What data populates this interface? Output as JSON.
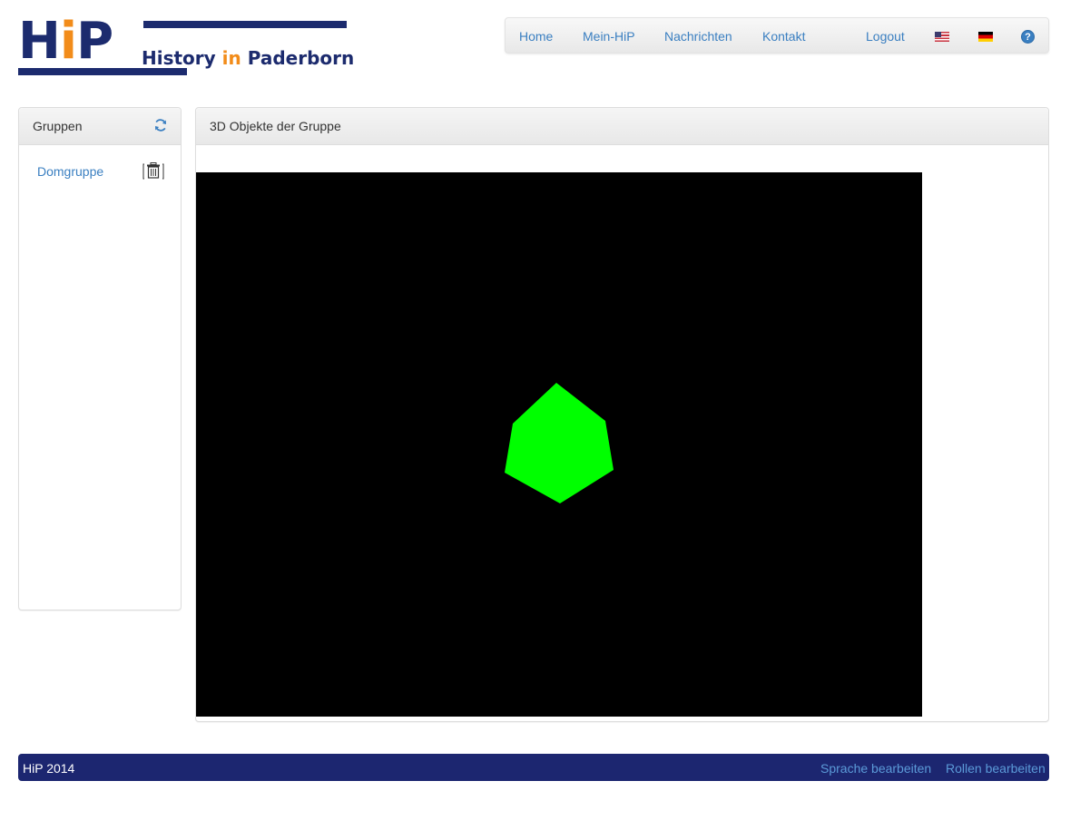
{
  "logo": {
    "hip_prefix": "H",
    "hip_i": "i",
    "hip_suffix": "P",
    "text_history": "History ",
    "text_in": "in",
    "text_paderborn": " Paderborn"
  },
  "nav": {
    "home": "Home",
    "mein_hip": "Mein-HiP",
    "nachrichten": "Nachrichten",
    "kontakt": "Kontakt",
    "logout": "Logout",
    "help_glyph": "?"
  },
  "groups_panel": {
    "title": "Gruppen",
    "items": [
      {
        "label": "Domgruppe"
      }
    ]
  },
  "objects_panel": {
    "title": "3D Objekte der Gruppe",
    "object_color": "#00ff00",
    "background_color": "#000000"
  },
  "footer": {
    "copyright": "HiP 2014",
    "edit_language": "Sprache bearbeiten",
    "edit_roles": "Rollen bearbeiten"
  },
  "colors": {
    "brand_blue": "#1c2b6e",
    "brand_orange": "#f28c1a",
    "link_blue": "#3a7fc1",
    "footer_bg": "#1c2670"
  }
}
